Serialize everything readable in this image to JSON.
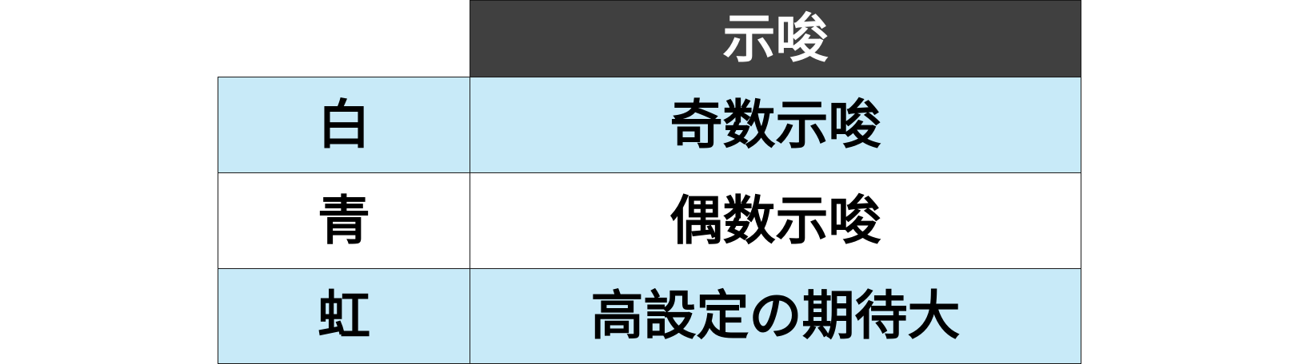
{
  "table": {
    "header": "示唆",
    "rows": [
      {
        "color": "白",
        "meaning": "奇数示唆"
      },
      {
        "color": "青",
        "meaning": "偶数示唆"
      },
      {
        "color": "虹",
        "meaning": "高設定の期待大"
      }
    ]
  },
  "colors": {
    "header_bg": "#404040",
    "row_highlight": "#c8eaf8",
    "row_plain": "#ffffff"
  }
}
